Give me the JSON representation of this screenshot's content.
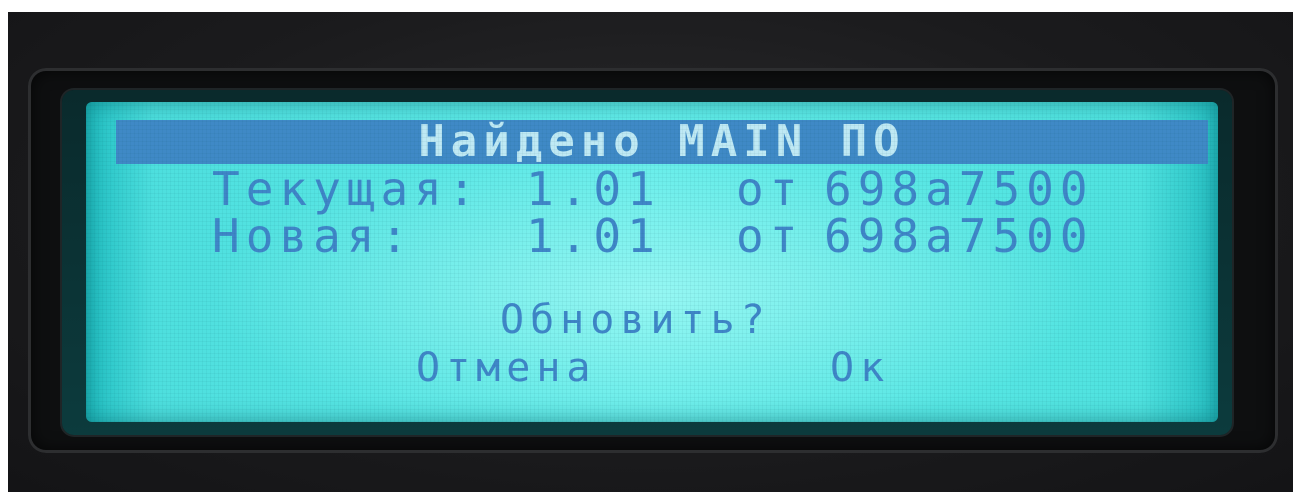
{
  "screen": {
    "title": "Найдено MAIN ПО",
    "current": {
      "label": "Текущая:",
      "version": "1.01",
      "from": "от",
      "date": "698a7500"
    },
    "new": {
      "label": "Новая:",
      "version": "1.01",
      "from": "от",
      "date": "698a7500"
    },
    "question": "Обновить?",
    "buttons": {
      "cancel": "Отмена",
      "ok": "Ок"
    }
  },
  "colors": {
    "lcd_background": "#62ece9",
    "title_bar": "#3f89c6",
    "title_text": "#bfe9f4",
    "lcd_text": "#3f86c8",
    "device_body": "#1b1b1d"
  }
}
